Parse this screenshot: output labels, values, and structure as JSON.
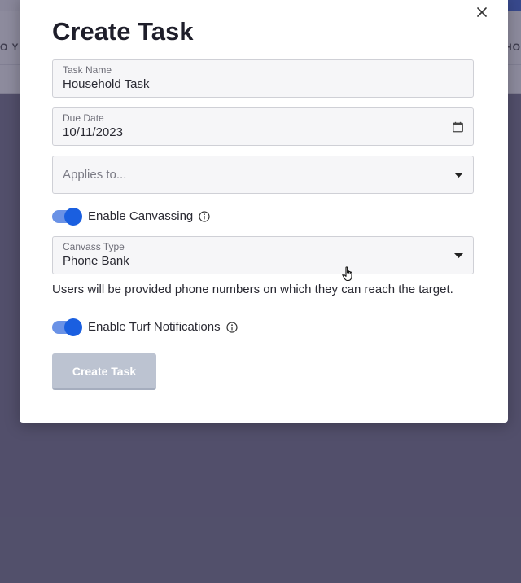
{
  "modal": {
    "title": "Create Task",
    "close_icon": "close-icon",
    "fields": {
      "task_name": {
        "label": "Task Name",
        "value": "Household Task"
      },
      "due_date": {
        "label": "Due Date",
        "value": "10/11/2023",
        "icon": "calendar-icon"
      },
      "applies_to": {
        "placeholder": "Applies to...",
        "icon": "chevron-down-icon"
      },
      "canvass_type": {
        "label": "Canvass Type",
        "value": "Phone Bank",
        "icon": "chevron-down-icon"
      }
    },
    "toggles": {
      "canvassing": {
        "label": "Enable Canvassing",
        "on": true,
        "icon": "info-icon"
      },
      "turf_notifications": {
        "label": "Enable Turf Notifications",
        "on": true,
        "icon": "info-icon"
      }
    },
    "description": "Users will be provided phone numbers on which they can reach the target.",
    "submit_label": "Create Task"
  },
  "background": {
    "left_fragment": "O Y",
    "right_fragment": "HO"
  },
  "colors": {
    "toggle_track": "#6a92e6",
    "toggle_knob": "#1a5fe0",
    "button_disabled": "#bcc3d1",
    "overlay": "#61607a",
    "accent": "#1f4fd1"
  }
}
